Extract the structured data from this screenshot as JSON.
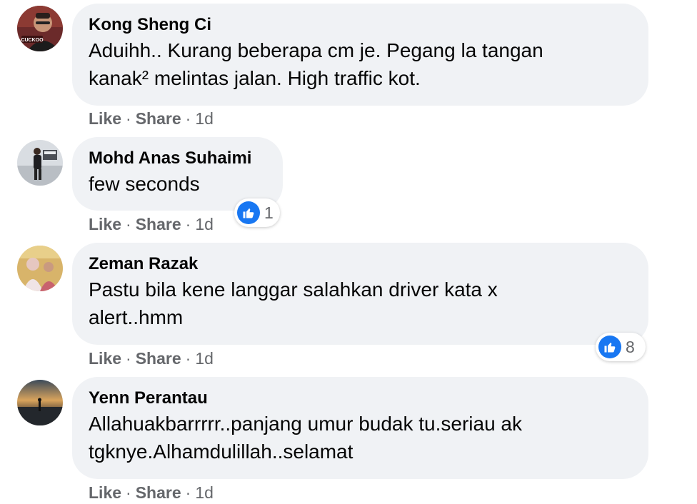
{
  "comments": [
    {
      "author": "Kong Sheng Ci",
      "avatar_badge": "CUCKOO",
      "text": "Aduihh.. Kurang beberapa cm je. Pegang la tangan kanak² melintas jalan. High traffic kot.",
      "actions": {
        "like": "Like",
        "share": "Share",
        "time": "1d"
      }
    },
    {
      "author": "Mohd Anas Suhaimi",
      "text": "few seconds",
      "actions": {
        "like": "Like",
        "share": "Share",
        "time": "1d"
      },
      "reaction_count": "1"
    },
    {
      "author": "Zeman Razak",
      "text": "Pastu bila kene langgar salahkan driver kata x alert..hmm",
      "actions": {
        "like": "Like",
        "share": "Share",
        "time": "1d"
      },
      "reaction_count": "8"
    },
    {
      "author": "Yenn Perantau",
      "text": "Allahuakbarrrrr..panjang umur budak tu.seriau ak tgknye.Alhamdulillah..selamat",
      "actions": {
        "like": "Like",
        "share": "Share",
        "time": "1d"
      }
    }
  ],
  "separator": "·",
  "colors": {
    "bubble": "#f0f2f5",
    "meta": "#65676b",
    "like_blue": "#1877f2",
    "text": "#050505"
  },
  "icons": {
    "reaction": "thumbs-up-icon"
  }
}
